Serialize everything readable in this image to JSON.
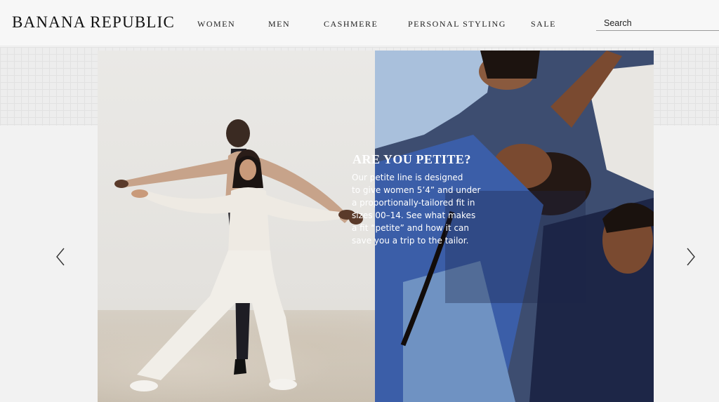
{
  "brand": {
    "logo_text": "BANANA REPUBLIC"
  },
  "nav": {
    "items": [
      {
        "label": "WOMEN"
      },
      {
        "label": "MEN"
      },
      {
        "label": "CASHMERE"
      },
      {
        "label": "PERSONAL STYLING"
      },
      {
        "label": "SALE"
      }
    ]
  },
  "search": {
    "placeholder": "Search"
  },
  "hero": {
    "promo_title": "ARE YOU PETITE?",
    "promo_lines": [
      "Our petite line is designed",
      "to give women 5’4” and under",
      "a proportionally-tailored fit in",
      "sizes 00–14. See what makes",
      "a fit “petite” and how it can",
      "save you a trip to the tailor."
    ]
  },
  "carousel": {
    "prev_icon": "chevron-left-icon",
    "next_icon": "chevron-right-icon"
  },
  "colors": {
    "header_bg": "#f7f7f7",
    "page_bg": "#f2f2f2",
    "promo_text": "#ffffff"
  }
}
